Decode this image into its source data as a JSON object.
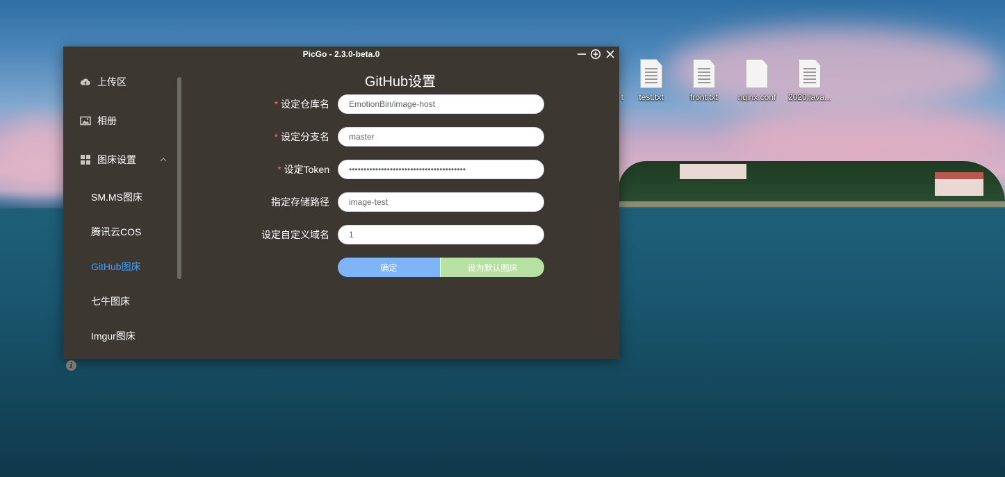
{
  "desktop": {
    "icons": [
      {
        "label": "test.txt",
        "icon": "text-file-icon"
      },
      {
        "label": "front.txt",
        "icon": "text-file-icon"
      },
      {
        "label": "nginx.conf",
        "icon": "blank-file-icon"
      },
      {
        "label": "2020.java...",
        "icon": "text-file-icon"
      }
    ],
    "partial_label": "t"
  },
  "window": {
    "title": "PicGo - 2.3.0-beta.0",
    "controls": [
      "minimize-icon",
      "pin-icon",
      "close-icon"
    ]
  },
  "sidebar": {
    "items": [
      {
        "label": "上传区",
        "icon": "cloud-upload-icon"
      },
      {
        "label": "相册",
        "icon": "image-icon"
      },
      {
        "label": "图床设置",
        "icon": "grid-icon",
        "expanded": true
      }
    ],
    "sub_items": [
      {
        "label": "SM.MS图床",
        "active": false
      },
      {
        "label": "腾讯云COS",
        "active": false
      },
      {
        "label": "GitHub图床",
        "active": true
      },
      {
        "label": "七牛图床",
        "active": false
      },
      {
        "label": "Imgur图床",
        "active": false
      }
    ],
    "info_glyph": "i"
  },
  "main": {
    "title": "GitHub设置",
    "fields": [
      {
        "label": "设定仓库名",
        "required": true,
        "value": "EmotionBin/image-host"
      },
      {
        "label": "设定分支名",
        "required": true,
        "value": "master"
      },
      {
        "label": "设定Token",
        "required": true,
        "value": "••••••••••••••••••••••••••••••••••••••••"
      },
      {
        "label": "指定存储路径",
        "required": false,
        "value": "image-test"
      },
      {
        "label": "设定自定义域名",
        "required": false,
        "value": "1"
      }
    ],
    "required_mark": "*",
    "confirm_label": "确定",
    "set_default_label": "设为默认图床"
  },
  "colors": {
    "window_bg": "#3c3731",
    "active_link": "#409eff",
    "required": "#f56c6c",
    "confirm_btn": "#7fb5f7",
    "default_btn": "#b7e0a3"
  }
}
